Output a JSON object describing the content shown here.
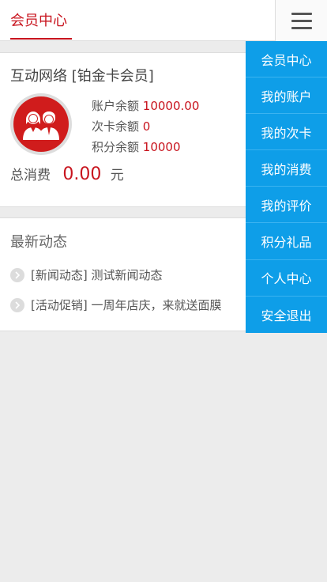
{
  "header": {
    "title": "会员中心",
    "menu_icon": "hamburger-icon"
  },
  "member": {
    "name": "互动网络 [铂金卡会员]",
    "account_balance_label": "账户余额",
    "account_balance": "10000.00",
    "card_balance_label": "次卡余额",
    "card_balance": "0",
    "points_balance_label": "积分余额",
    "points_balance": "10000",
    "total_label": "总消费",
    "total_amount": "0.00",
    "total_unit": "元"
  },
  "news": {
    "heading": "最新动态",
    "items": [
      {
        "text": "[新闻动态] 测试新闻动态"
      },
      {
        "text": "[活动促销] 一周年店庆，来就送面膜"
      }
    ]
  },
  "side_menu": {
    "items": [
      {
        "label": "会员中心"
      },
      {
        "label": "我的账户"
      },
      {
        "label": "我的次卡"
      },
      {
        "label": "我的消费"
      },
      {
        "label": "我的评价"
      },
      {
        "label": "积分礼品"
      },
      {
        "label": "个人中心"
      },
      {
        "label": "安全退出"
      }
    ]
  },
  "colors": {
    "accent": "#c8141e",
    "menu_bg": "#0e9ee8",
    "page_bg": "#ececec"
  }
}
